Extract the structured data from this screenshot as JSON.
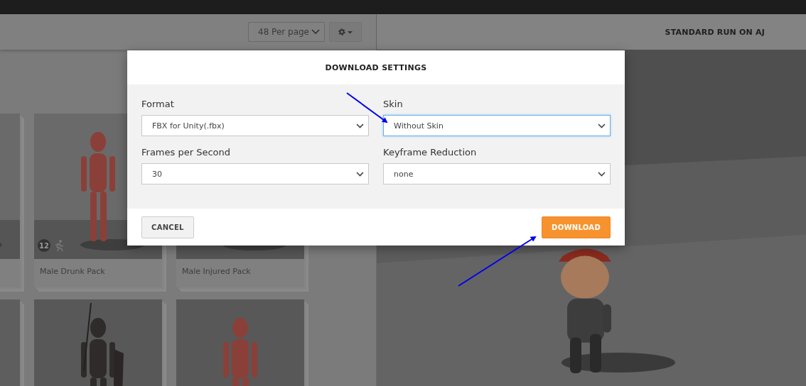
{
  "toolbar": {
    "per_page": "48 Per page"
  },
  "preview": {
    "title": "STANDARD RUN ON AJ"
  },
  "cards": [
    {
      "title": "Male Drunk Pack",
      "badge": "12"
    },
    {
      "title": "Male Injured Pack"
    }
  ],
  "dialog": {
    "title": "DOWNLOAD SETTINGS",
    "fields": [
      {
        "label": "Format",
        "value": "FBX for Unity(.fbx)",
        "focused": false
      },
      {
        "label": "Skin",
        "value": "Without Skin",
        "focused": true
      },
      {
        "label": "Frames per Second",
        "value": "30",
        "focused": false
      },
      {
        "label": "Keyframe Reduction",
        "value": "none",
        "focused": false
      }
    ],
    "buttons": [
      {
        "kind": "secondary",
        "label": "CANCEL"
      },
      {
        "kind": "primary",
        "label": "DOWNLOAD"
      }
    ]
  }
}
